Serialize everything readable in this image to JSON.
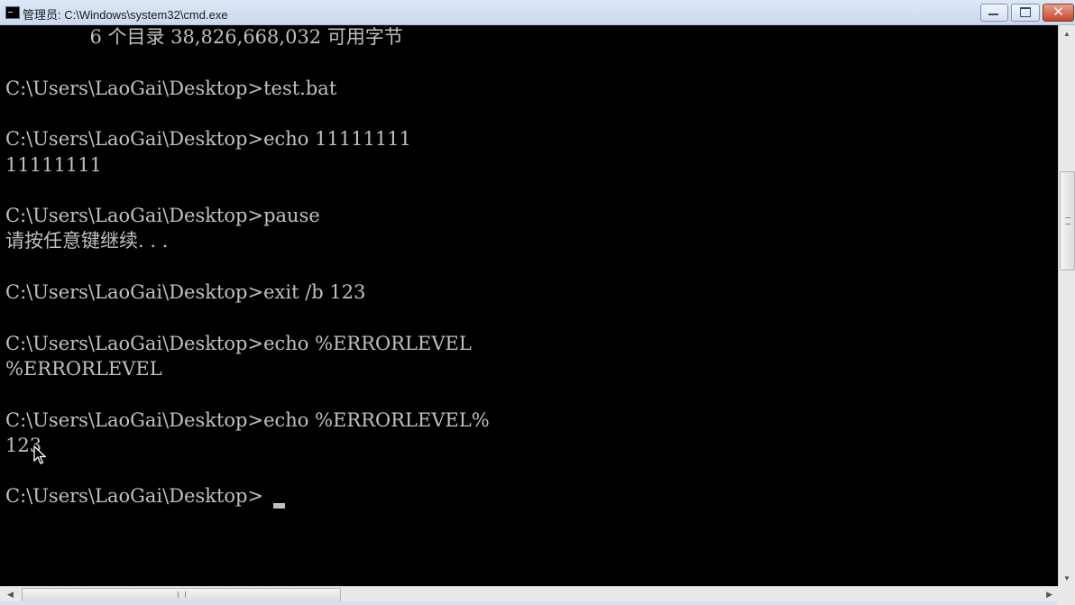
{
  "window": {
    "title": "管理员: C:\\Windows\\system32\\cmd.exe",
    "close_glyph": "✕"
  },
  "console": {
    "lines": [
      "              6 个目录 38,826,668,032 可用字节",
      "",
      "C:\\Users\\LaoGai\\Desktop>test.bat",
      "",
      "C:\\Users\\LaoGai\\Desktop>echo 11111111",
      "11111111",
      "",
      "C:\\Users\\LaoGai\\Desktop>pause",
      "请按任意键继续. . .",
      "",
      "C:\\Users\\LaoGai\\Desktop>exit /b 123",
      "",
      "C:\\Users\\LaoGai\\Desktop>echo %ERRORLEVEL",
      "%ERRORLEVEL",
      "",
      "C:\\Users\\LaoGai\\Desktop>echo %ERRORLEVEL%",
      "123",
      "",
      "C:\\Users\\LaoGai\\Desktop>"
    ]
  },
  "scrollbars": {
    "up_arrow": "▲",
    "down_arrow": "▼",
    "left_arrow": "◀",
    "right_arrow": "▶"
  }
}
